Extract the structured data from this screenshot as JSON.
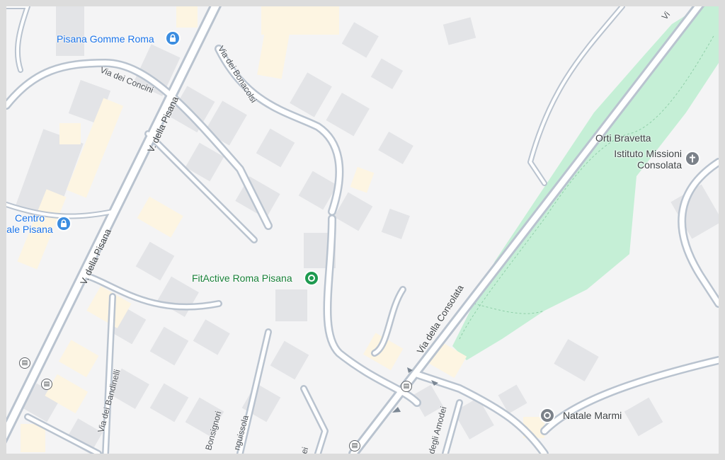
{
  "colors": {
    "background": "#f4f4f5",
    "frame": "#dcdcdc",
    "building": "#e3e4e7",
    "building_highlight": "#fdf5e2",
    "road_fill": "#ffffff",
    "road_edge": "#b9c3cf",
    "park": "#c5efd6",
    "poi_blue": "#1a73e8",
    "poi_green": "#188038",
    "poi_gray": "#3c4043"
  },
  "places": {
    "pisana_gomme_roma": {
      "name": "Pisana Gomme Roma",
      "icon": "lock-icon",
      "category": "shopping"
    },
    "centro_pisana": {
      "name_line1": "Centro",
      "name_line2": "ale Pisana",
      "icon": "lock-icon",
      "category": "shopping"
    },
    "fitactive": {
      "name": "FitActive Roma Pisana",
      "icon": "circle-marker-icon",
      "category": "fitness"
    },
    "istituto": {
      "name_line1": "Istituto Missioni",
      "name_line2": "Consolata",
      "icon": "cross-icon",
      "category": "religious"
    },
    "natale_marmi": {
      "name": "Natale Marmi",
      "icon": "circle-marker-icon",
      "category": "business"
    }
  },
  "park": {
    "name": "Orti Bravetta"
  },
  "streets": {
    "via_dei_concini": "Via dei Concini",
    "v_della_pisana_1": "V. della Pisana",
    "v_della_pisana_2": "V. della Pisana",
    "via_dei_bonacolsi": "Via dei Bonacolsi",
    "via_della_consolata": "Via della Consolata",
    "via_dei_bandinelli": "Via dei Bandinelli",
    "bonsignori": "Bonsignori",
    "anguissola": "nguissola",
    "degli_amodei": "degli Amodei",
    "via_top_right": "Vi",
    "bottom_fragment": "ei"
  }
}
